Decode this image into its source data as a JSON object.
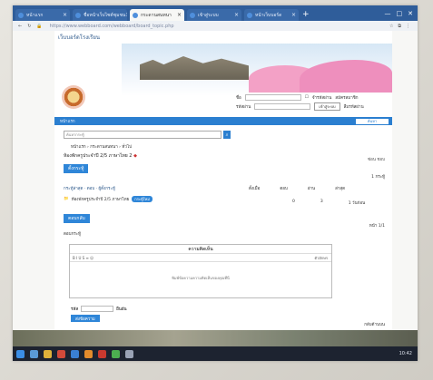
{
  "browser": {
    "tabs": [
      {
        "label": "หน้าแรก",
        "active": false
      },
      {
        "label": "ชื่อหน้าเว็บไซต์ชุมชน",
        "active": false
      },
      {
        "label": "กระดานสนทนา",
        "active": true
      },
      {
        "label": "เข้าสู่ระบบ",
        "active": false
      },
      {
        "label": "หน้าเว็บบอร์ด",
        "active": false
      }
    ],
    "new_tab": "+",
    "window_controls": [
      "—",
      "□",
      "✕"
    ],
    "url": "https://www.webboard.com/webboard/board_topic.php"
  },
  "site": {
    "title": "เว็บบอร์ดโรงเรียน",
    "login_user_label": "ชื่อ",
    "login_pass_label": "รหัสผ่าน",
    "login_button": "เข้าสู่ระบบ",
    "register_link": "สมัครสมาชิก",
    "remember_label": "จำรหัสผ่าน",
    "forgot_link": "ลืมรหัสผ่าน",
    "bluebar_left": "หน้าแรก",
    "bluebar_button": "ค้นหา",
    "search_placeholder": "ค้นหากระทู้",
    "breadcrumb": "หน้าแรก › กระดานสนทนา › ทั่วไป",
    "topic_title": "ห้องพักครูประจำปี 2/5 ภาษาไทย 2",
    "topic_title_mark": "◆",
    "icons_right": "ซ่อน  ชอบ",
    "new_topic_button": "ตั้งกระทู้",
    "count_text": "1 กระทู้",
    "post_header": "กระทู้ล่าสุด · ตอบ · ผู้ตั้งกระทู้",
    "col_headers": [
      "ตั้งเมื่อ",
      "ตอบ",
      "อ่าน",
      "ล่าสุด"
    ],
    "post_row_text": "ห้องพักครูประจำปี 2/5 ภาษาไทย",
    "post_row_badge": "กระทู้ใหม่",
    "post_values": [
      "0",
      "3",
      "1 วันก่อน"
    ],
    "reply_button": "ตอบกลับ",
    "page_count": "หน้า 1/1",
    "reply_label": "ตอบกระทู้",
    "editor_title": "ความคิดเห็น",
    "editor_toolbar": "B  I  U  S  ≡  ☺",
    "editor_toolbar_right": "ตัวอักษร",
    "editor_placeholder": "พิมพ์ข้อความความคิดเห็นของคุณที่นี่",
    "captcha_label": "รหัส",
    "captcha_hint": "ยืนยัน",
    "submit_button": "ส่งข้อความ",
    "footer_right": "กลับด้านบน"
  },
  "taskbar": {
    "clock": "10:42"
  }
}
